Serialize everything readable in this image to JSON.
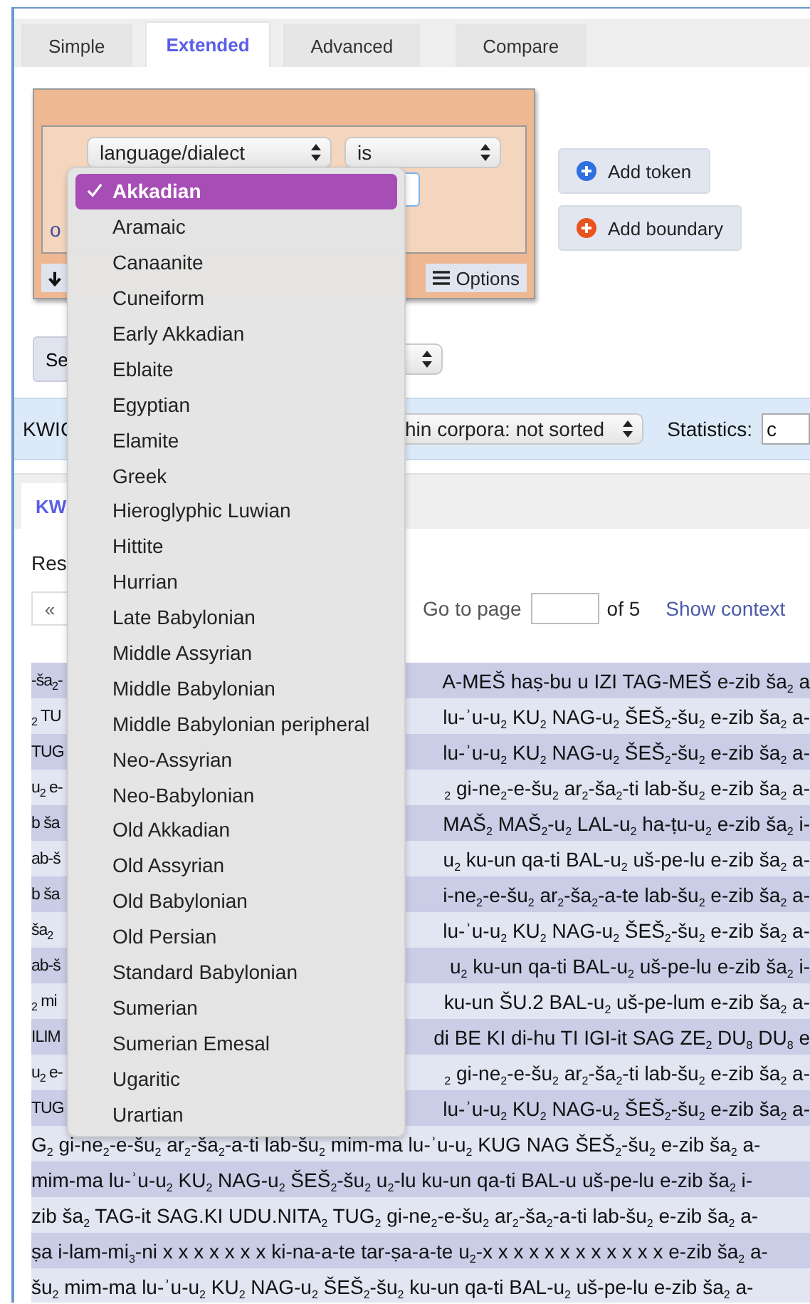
{
  "tabs": [
    {
      "label": "Simple",
      "selected": false
    },
    {
      "label": "Extended",
      "selected": true
    },
    {
      "label": "Advanced",
      "selected": false
    },
    {
      "label": "Compare",
      "selected": false
    }
  ],
  "query": {
    "attribute": "language/dialect",
    "operator": "is",
    "or_link": "o",
    "options_button": "Options"
  },
  "add_buttons": [
    {
      "label": "Add token",
      "kind": "token"
    },
    {
      "label": "Add boundary",
      "kind": "boundary"
    }
  ],
  "search_button": "Se",
  "kwic_bar": {
    "label": "KWIC",
    "sort": "hin corpora: not sorted",
    "statistics_label": "Statistics:",
    "statistics_value": "c"
  },
  "result_tabs": [
    {
      "label": "KW",
      "selected": true
    }
  ],
  "results_label": "Res",
  "pagination": {
    "prev": "«",
    "go_to": "Go to page",
    "total": "of 5",
    "show_context": "Show context"
  },
  "rows": [
    {
      "kind": "split",
      "left": "-ša$_{2}$-",
      "right": "A-MEŠ haṣ-bu u IZI TAG-MEŠ e-zib ša$_{2}$ a"
    },
    {
      "kind": "split",
      "left": "$_{2}$ TU",
      "right": "lu-ʾu-u$_{2}$ KU$_{2}$ NAG-u$_{2}$ ŠEŠ$_{2}$-šu$_{2}$ e-zib ša$_{2}$ a-"
    },
    {
      "kind": "split",
      "left": "TUG",
      "right": "lu-ʾu-u$_{2}$ KU$_{2}$ NAG-u$_{2}$ ŠEŠ$_{2}$-šu$_{2}$ e-zib ša$_{2}$ a-"
    },
    {
      "kind": "split",
      "left": "u$_{2}$ e-",
      "right": "$_{2}$ gi-ne$_{2}$-e-šu$_{2}$ ar$_{2}$-ša$_{2}$-ti lab-šu$_{2}$ e-zib ša$_{2}$ a-"
    },
    {
      "kind": "split",
      "left": "b ša",
      "right": "MAŠ$_{2}$ MAŠ$_{2}$-u$_{2}$ LAL-u$_{2}$ ha-ṭu-u$_{2}$ e-zib ša$_{2}$ i-"
    },
    {
      "kind": "split",
      "left": "ab-š",
      "right": "u$_{2}$ ku-un qa-ti BAL-u$_{2}$ uš-pe-lu e-zib ša$_{2}$ a-"
    },
    {
      "kind": "split",
      "left": "b ša",
      "right": "i-ne$_{2}$-e-šu$_{2}$ ar$_{2}$-ša$_{2}$-a-te lab-šu$_{2}$ e-zib ša$_{2}$ a-"
    },
    {
      "kind": "split",
      "left": "ša$_{2}$",
      "right": "lu-ʾu-u$_{2}$ KU$_{2}$ NAG-u$_{2}$ ŠEŠ$_{2}$-šu$_{2}$ e-zib ša$_{2}$ a-"
    },
    {
      "kind": "split",
      "left": "ab-š",
      "right": "u$_{2}$ ku-un qa-ti BAL-u$_{2}$ uš-pe-lu e-zib ša$_{2}$ i-"
    },
    {
      "kind": "split",
      "left": "$_{2}$ mi",
      "right": "ku-un ŠU.2 BAL-u$_{2}$ uš-pe-lum e-zib ša$_{2}$ a-"
    },
    {
      "kind": "split",
      "left": "ILIM",
      "right": "di BE KI di-hu TI IGI-it SAG ZE$_{2}$ DU$_{8}$ DU$_{8}$ e"
    },
    {
      "kind": "split",
      "left": "u$_{2}$ e-",
      "right": "$_{2}$ gi-ne$_{2}$-e-šu$_{2}$ ar$_{2}$-ša$_{2}$-ti lab-šu$_{2}$ e-zib ša$_{2}$ a-"
    },
    {
      "kind": "split",
      "left": "TUG",
      "right": "lu-ʾu-u$_{2}$ KU$_{2}$ NAG-u$_{2}$ ŠEŠ$_{2}$-šu$_{2}$ e-zib ša$_{2}$ a-"
    },
    {
      "kind": "full",
      "text": "G$_{2}$ gi-ne$_{2}$-e-šu$_{2}$ ar$_{2}$-ša$_{2}$-a-ti lab-šu$_{2}$ mim-ma lu-ʾu-u$_{2}$ KUG NAG ŠEŠ$_{2}$-šu$_{2}$ e-zib ša$_{2}$ a-"
    },
    {
      "kind": "full",
      "text": "mim-ma lu-ʾu-u$_{2}$ KU$_{2}$ NAG-u$_{2}$ ŠEŠ$_{2}$-šu$_{2}$ u$_{2}$-lu ku-un qa-ti BAL-u uš-pe-lu e-zib ša$_{2}$ i-"
    },
    {
      "kind": "full",
      "text": "zib ša$_{2}$ TAG-it SAG.KI UDU.NITA$_{2}$ TUG$_{2}$ gi-ne$_{2}$-e-šu$_{2}$ ar$_{2}$-ša$_{2}$-a-ti lab-šu$_{2}$ e-zib ša$_{2}$ a-"
    },
    {
      "kind": "full",
      "text": "ṣa i-lam-mi$_{3}$-ni x x x x x x x ki-na-a-te tar-ṣa-a-te u$_{2}$-x x x x x x x x x x x x e-zib ša$_{2}$ a-"
    },
    {
      "kind": "full",
      "text": "šu$_{2}$ mim-ma lu-ʾu-u$_{2}$ KU$_{2}$ NAG-u$_{2}$ ŠEŠ$_{2}$-šu$_{2}$ ku-un qa-ti BAL-u$_{2}$ uš-pe-lu e-zib ša$_{2}$ a-"
    }
  ],
  "dropdown": [
    {
      "label": "Akkadian",
      "selected": true
    },
    {
      "label": "Aramaic",
      "selected": false
    },
    {
      "label": "Canaanite",
      "selected": false
    },
    {
      "label": "Cuneiform",
      "selected": false
    },
    {
      "label": "Early Akkadian",
      "selected": false
    },
    {
      "label": "Eblaite",
      "selected": false
    },
    {
      "label": "Egyptian",
      "selected": false
    },
    {
      "label": "Elamite",
      "selected": false
    },
    {
      "label": "Greek",
      "selected": false
    },
    {
      "label": "Hieroglyphic Luwian",
      "selected": false
    },
    {
      "label": "Hittite",
      "selected": false
    },
    {
      "label": "Hurrian",
      "selected": false
    },
    {
      "label": "Late Babylonian",
      "selected": false
    },
    {
      "label": "Middle Assyrian",
      "selected": false
    },
    {
      "label": "Middle Babylonian",
      "selected": false
    },
    {
      "label": "Middle Babylonian peripheral",
      "selected": false
    },
    {
      "label": "Neo-Assyrian",
      "selected": false
    },
    {
      "label": "Neo-Babylonian",
      "selected": false
    },
    {
      "label": "Old Akkadian",
      "selected": false
    },
    {
      "label": "Old Assyrian",
      "selected": false
    },
    {
      "label": "Old Babylonian",
      "selected": false
    },
    {
      "label": "Old Persian",
      "selected": false
    },
    {
      "label": "Standard Babylonian",
      "selected": false
    },
    {
      "label": "Sumerian",
      "selected": false
    },
    {
      "label": "Sumerian Emesal",
      "selected": false
    },
    {
      "label": "Ugaritic",
      "selected": false
    },
    {
      "label": "Urartian",
      "selected": false
    }
  ]
}
